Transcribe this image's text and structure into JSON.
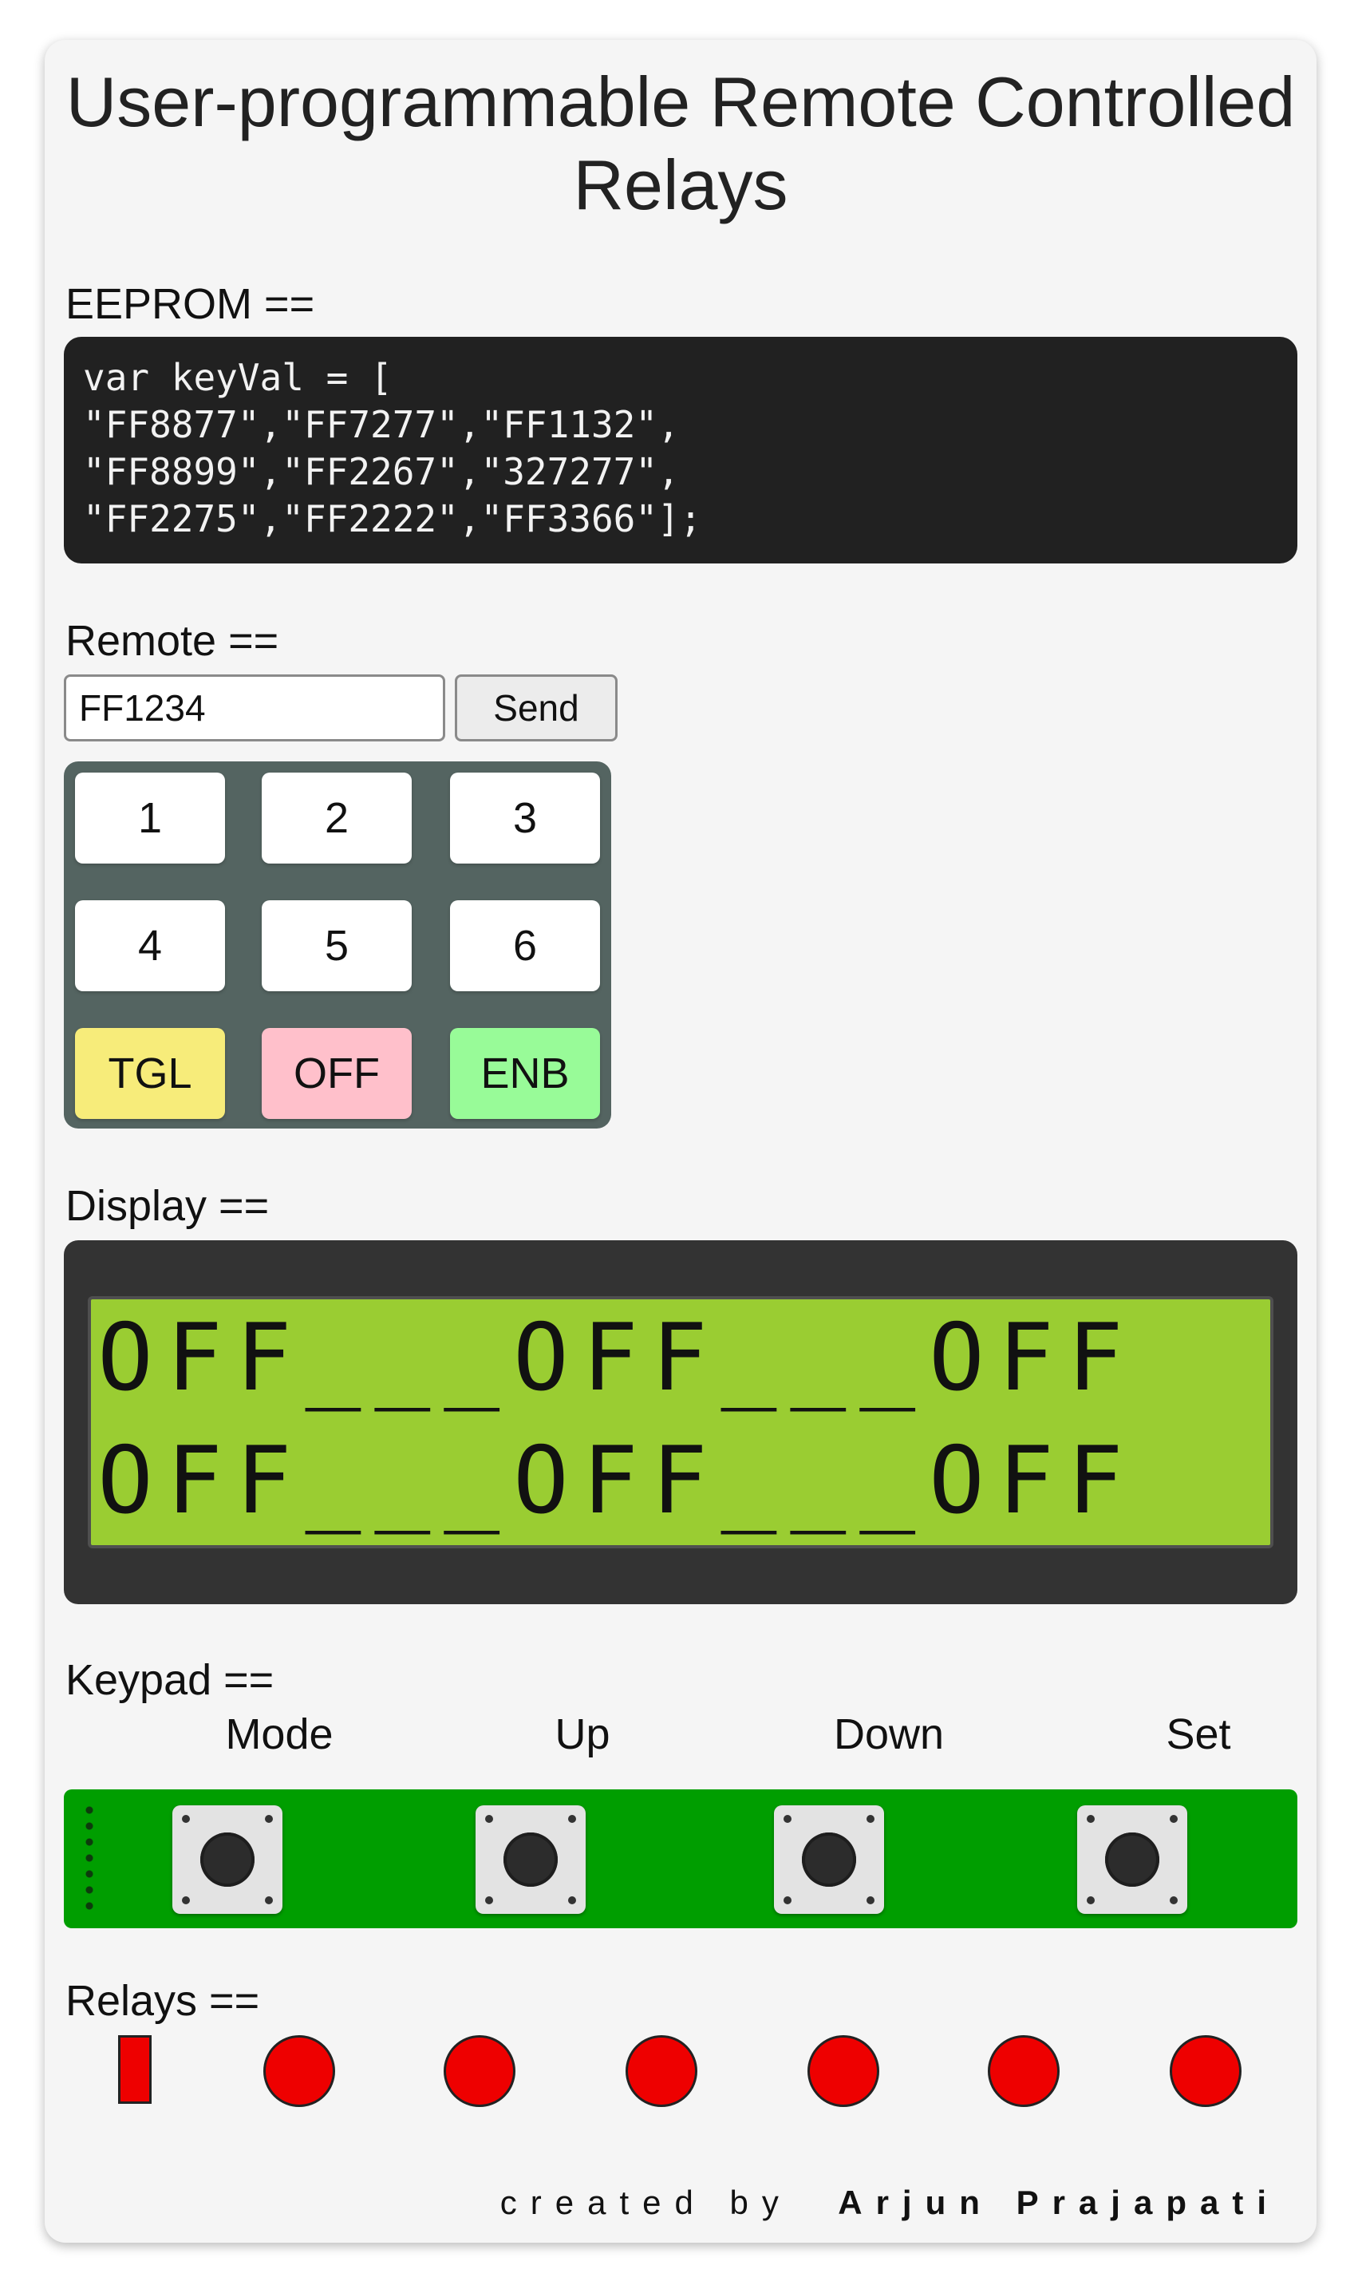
{
  "title": "User-programmable Remote Controlled Relays",
  "eeprom": {
    "label": "EEPROM ==",
    "code": "var keyVal = [\n\"FF8877\",\"FF7277\",\"FF1132\",\n\"FF8899\",\"FF2267\",\"327277\",\n\"FF2275\",\"FF2222\",\"FF3366\"];"
  },
  "remote": {
    "label": "Remote ==",
    "input_value": "FF1234",
    "send_label": "Send",
    "keys": [
      "1",
      "2",
      "3",
      "4",
      "5",
      "6",
      "TGL",
      "OFF",
      "ENB"
    ],
    "key_colors": {
      "TGL": "#f7ec7a",
      "OFF": "#ffc0cb",
      "ENB": "#98fb98"
    }
  },
  "display": {
    "label": "Display ==",
    "line1": "OFF___OFF___OFF",
    "line2": "OFF___OFF___OFF",
    "lcd_color": "#9acd32"
  },
  "keypad": {
    "label": "Keypad ==",
    "buttons": [
      "Mode",
      "Up",
      "Down",
      "Set"
    ],
    "board_color": "#009e00"
  },
  "relays": {
    "label": "Relays ==",
    "states": [
      "off",
      "off",
      "off",
      "off",
      "off",
      "off"
    ],
    "off_color": "#ee0000"
  },
  "footer": {
    "created_by": "created by",
    "author": "Arjun Prajapati"
  }
}
